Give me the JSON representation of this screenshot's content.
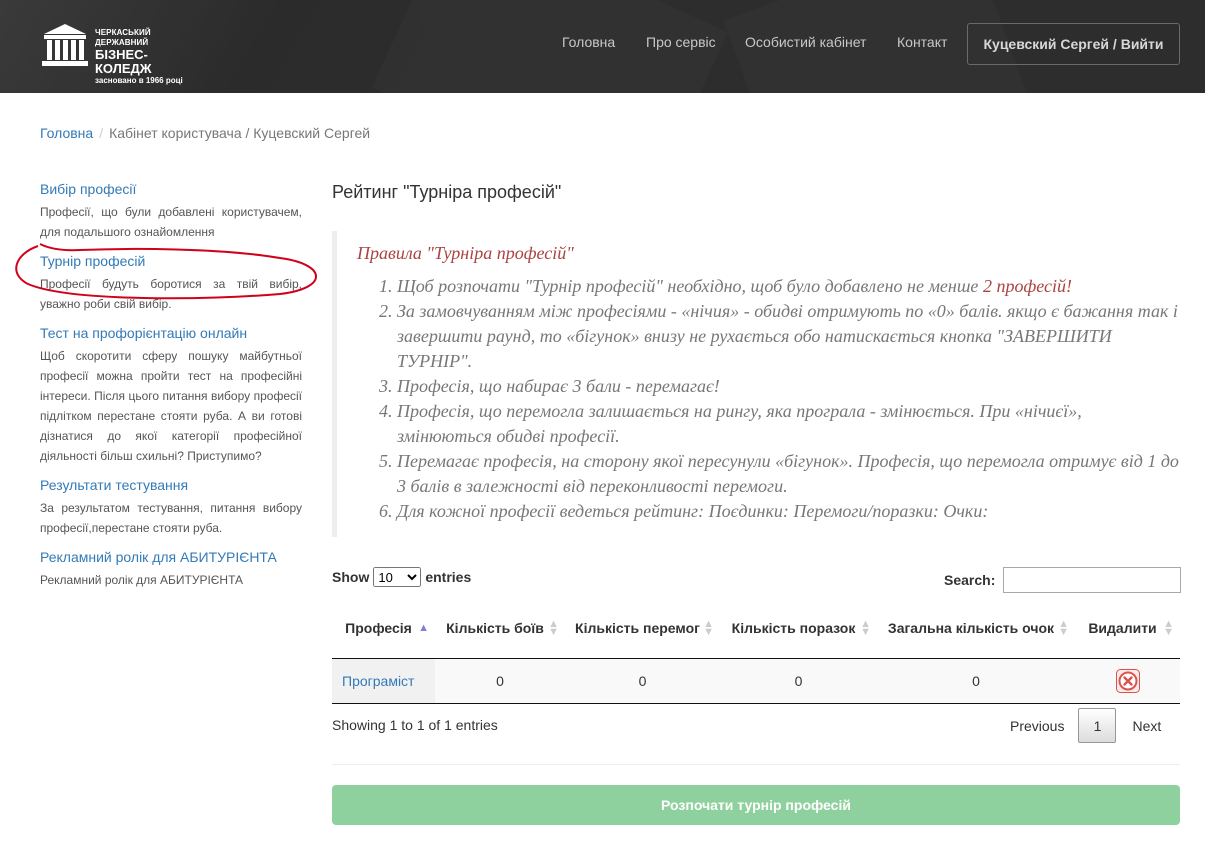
{
  "header": {
    "logo": {
      "line1": "ЧЕРКАСЬКИЙ ДЕРЖАВНИЙ",
      "line2": "БІЗНЕС-КОЛЕДЖ",
      "line3": "засновано в 1966 році"
    },
    "nav": [
      "Головна",
      "Про сервіс",
      "Особистий кабінет",
      "Контакт"
    ],
    "user_button": "Куцевский Сергей / Вийти"
  },
  "breadcrumb": {
    "home": "Головна",
    "current": "Кабінет користувача / Куцевский Сергей"
  },
  "sidebar": {
    "items": [
      {
        "title": "Вибір професії",
        "desc": "Професії, що були добавлені користувачем, для подальшого ознайомлення"
      },
      {
        "title": "Турнір професій",
        "desc": "Професії будуть боротися за твій вибір, уважно роби свій вибір."
      },
      {
        "title": "Тест на профорієнтацію онлайн",
        "desc": "Щоб скоротити сферу пошуку майбутньої професії можна пройти тест на професійні інтереси. Після цього питання вибору професії підлітком перестане стояти руба. А ви готові дізнатися до якої категорії професійної діяльності більш схильні? Приступимо?"
      },
      {
        "title": "Результати тестування",
        "desc": "За результатом тестування, питання вибору професії,перестане стояти руба."
      },
      {
        "title": "Рекламний ролік для АБИТУРІЄНТА",
        "desc": "Рекламний ролік для АБИТУРІЄНТА"
      }
    ]
  },
  "main": {
    "title": "Рейтинг \"Турніра професій\"",
    "rules_title": "Правила \"Турніра професій\"",
    "rules": {
      "r1_prefix": "Щоб розпочати \"Турнір професій\" необхідно, щоб було добавлено не менше ",
      "r1_highlight": "2 професій!",
      "r2": "За замовчуванням між професіями - «нічия» - обидві отримують по «0» балів. якщо є бажання так і завершити раунд, то «бігунок» внизу не рухається обо натискається кнопка \"ЗАВЕРШИТИ ТУРНІР\".",
      "r3": "Професія, що набирає 3 бали - перемагає!",
      "r4": "Професія, що перемогла залишається на рингу, яка програла - змінюється. При «нічиєї», змінюються обидві професії.",
      "r5": "Перемагає професія, на сторону якої пересунули «бігунок». Професія, що перемогла отримує від 1 до 3 балів в залежності від переконливості перемоги.",
      "r6": "Для кожної професії ведеться рейтинг: Поєдинки: Перемоги/поразки: Очки:"
    }
  },
  "table": {
    "show_label": "Show",
    "entries_label": "entries",
    "length_value": "10",
    "search_label": "Search:",
    "search_value": "",
    "columns": [
      "Професія",
      "Кількість боїв",
      "Кількість перемог",
      "Кількість поразок",
      "Загальна кількість очок",
      "Видалити"
    ],
    "rows": [
      {
        "profession": "Програміст",
        "battles": "0",
        "wins": "0",
        "losses": "0",
        "points": "0"
      }
    ],
    "info": "Showing 1 to 1 of 1 entries",
    "pager": {
      "previous": "Previous",
      "current": "1",
      "next": "Next"
    }
  },
  "start_button": "Розпочати турнір професій",
  "colors": {
    "header_bg": "#2d2d2d",
    "link": "#337ab7",
    "rules_title": "#a94442",
    "start_button": "#8fd19e",
    "delete": "#d9534f",
    "annotation": "#d0021b"
  }
}
